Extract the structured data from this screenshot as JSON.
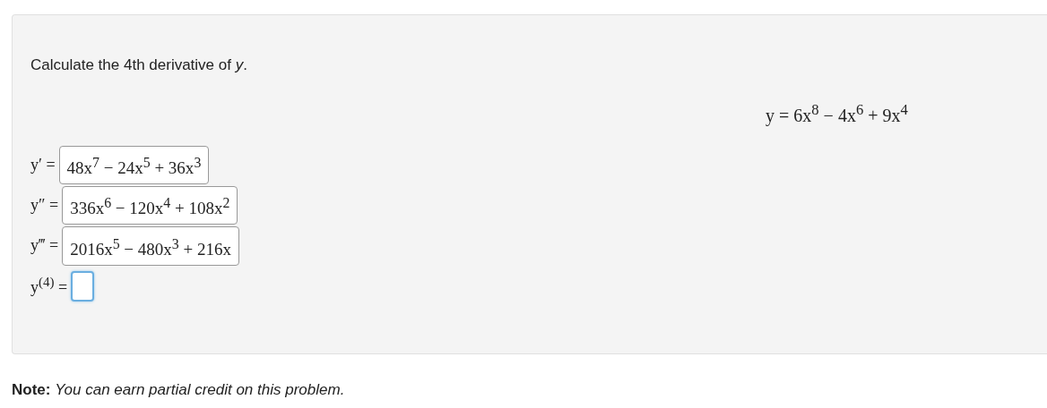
{
  "problem": {
    "prompt": "Calculate the 4th derivative of *y*.",
    "equation": "y = 6x$^{8}$ − 4x$^{6}$ + 9x$^{4}$",
    "answers": [
      {
        "label": "y′ =",
        "value": "48x$^{7}$ − 24x$^{5}$ + 36x$^{3}$",
        "focused": false
      },
      {
        "label": "y″ =",
        "value": "336x$^{6}$ − 120x$^{4}$ + 108x$^{2}$",
        "focused": false
      },
      {
        "label": "y‴ =",
        "value": "2016x$^{5}$ − 480x$^{3}$ + 216x",
        "focused": false
      },
      {
        "label": "y$^{(4)}$ =",
        "focused": true
      }
    ]
  },
  "note": "**Note:** *You can earn partial credit on this problem.*"
}
